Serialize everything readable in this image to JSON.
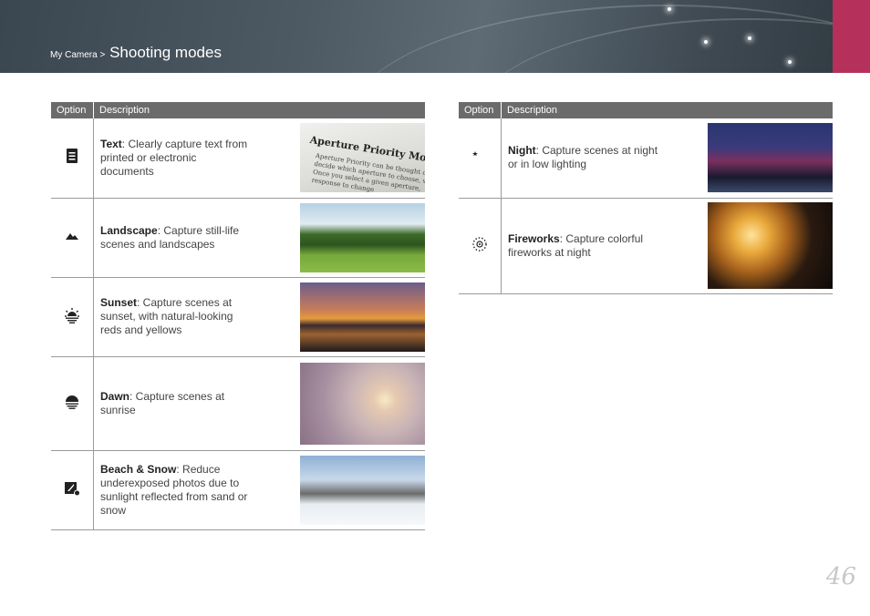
{
  "header": {
    "breadcrumb_prefix": "My Camera >",
    "title": "Shooting modes"
  },
  "left_table": {
    "col_option": "Option",
    "col_description": "Description",
    "rows": [
      {
        "icon": "text-mode-icon",
        "name": "Text",
        "desc": ": Clearly capture text from printed or electronic documents",
        "photo_caption_1": "Aperture Priority Mode",
        "photo_caption_2": "Aperture Priority can be thought of\ndecide which aperture to choose, wh\nOnce you select a given aperture,\nresponse to change"
      },
      {
        "icon": "landscape-mode-icon",
        "name": "Landscape",
        "desc": ": Capture still-life scenes and landscapes"
      },
      {
        "icon": "sunset-mode-icon",
        "name": "Sunset",
        "desc": ": Capture scenes at sunset, with natural-looking reds and yellows"
      },
      {
        "icon": "dawn-mode-icon",
        "name": "Dawn",
        "desc": ": Capture scenes at sunrise"
      },
      {
        "icon": "beach-snow-mode-icon",
        "name": "Beach & Snow",
        "desc": ": Reduce underexposed photos due to sunlight reflected from sand or snow"
      }
    ]
  },
  "right_table": {
    "col_option": "Option",
    "col_description": "Description",
    "rows": [
      {
        "icon": "night-mode-icon",
        "name": "Night",
        "desc": ": Capture scenes at night or in low lighting"
      },
      {
        "icon": "fireworks-mode-icon",
        "name": "Fireworks",
        "desc": ": Capture colorful fireworks at night"
      }
    ]
  },
  "page_number": "46",
  "colors": {
    "header_bg": "#4d5a64",
    "accent": "#b5305a",
    "table_header_bg": "#6b6b6b"
  }
}
